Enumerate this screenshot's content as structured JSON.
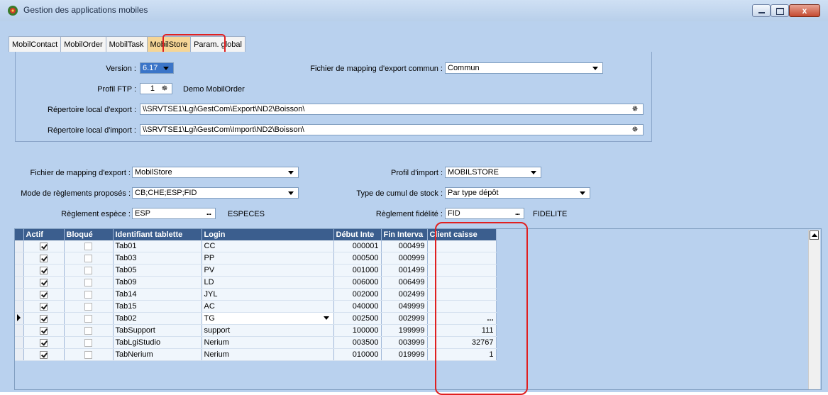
{
  "window": {
    "title": "Gestion des applications mobiles",
    "close_glyph": "x"
  },
  "tabs": [
    {
      "label": "MobilContact",
      "active": false
    },
    {
      "label": "MobilOrder",
      "active": false
    },
    {
      "label": "MobilTask",
      "active": false
    },
    {
      "label": "MobilStore",
      "active": true
    },
    {
      "label": "Param. global",
      "active": false
    }
  ],
  "panel_top": {
    "version_label": "Version :",
    "version_value": "6.17",
    "mapping_common_label": "Fichier de mapping d'export commun :",
    "mapping_common_value": "Commun",
    "profil_ftp_label": "Profil FTP :",
    "profil_ftp_value": "1",
    "profil_ftp_name": "Demo MobilOrder",
    "export_dir_label": "Répertoire local d'export :",
    "export_dir_value": "\\\\SRVTSE1\\Lgi\\GestCom\\Export\\ND2\\Boisson\\",
    "import_dir_label": "Répertoire local d'import :",
    "import_dir_value": "\\\\SRVTSE1\\Lgi\\GestCom\\Import\\ND2\\Boisson\\"
  },
  "panel_mid": {
    "mapping_export_label": "Fichier de mapping d'export :",
    "mapping_export_value": "MobilStore",
    "profil_import_label": "Profil d'import :",
    "profil_import_value": "MOBILSTORE",
    "reglements_label": "Mode de règlements proposés :",
    "reglements_value": "CB;CHE;ESP;FID",
    "cumul_label": "Type de cumul de stock :",
    "cumul_value": "Par type dépôt",
    "espece_label": "Règlement espèce :",
    "espece_value": "ESP",
    "espece_name": "ESPECES",
    "fidelite_label": "Règlement fidélité :",
    "fidelite_value": "FID",
    "fidelite_name": "FIDELITE",
    "dots": "..."
  },
  "grid": {
    "columns": [
      "Actif",
      "Bloqué",
      "Identifiant tablette",
      "Login",
      "Début Inte",
      "Fin Interva",
      "Client caisse"
    ],
    "rows": [
      {
        "actif": true,
        "bloque": false,
        "id": "Tab01",
        "login": "CC",
        "debut": "000001",
        "fin": "000499",
        "client": ""
      },
      {
        "actif": true,
        "bloque": false,
        "id": "Tab03",
        "login": "PP",
        "debut": "000500",
        "fin": "000999",
        "client": ""
      },
      {
        "actif": true,
        "bloque": false,
        "id": "Tab05",
        "login": "PV",
        "debut": "001000",
        "fin": "001499",
        "client": ""
      },
      {
        "actif": true,
        "bloque": false,
        "id": "Tab09",
        "login": "LD",
        "debut": "006000",
        "fin": "006499",
        "client": ""
      },
      {
        "actif": true,
        "bloque": false,
        "id": "Tab14",
        "login": "JYL",
        "debut": "002000",
        "fin": "002499",
        "client": ""
      },
      {
        "actif": true,
        "bloque": false,
        "id": "Tab15",
        "login": "AC",
        "debut": "040000",
        "fin": "049999",
        "client": ""
      },
      {
        "actif": true,
        "bloque": false,
        "id": "Tab02",
        "login": "TG",
        "debut": "002500",
        "fin": "002999",
        "client": "...",
        "current": true
      },
      {
        "actif": true,
        "bloque": false,
        "id": "TabSupport",
        "login": "support",
        "debut": "100000",
        "fin": "199999",
        "client": "111"
      },
      {
        "actif": true,
        "bloque": false,
        "id": "TabLgiStudio",
        "login": "Nerium",
        "debut": "003500",
        "fin": "003999",
        "client": "32767"
      },
      {
        "actif": true,
        "bloque": false,
        "id": "TabNerium",
        "login": "Nerium",
        "debut": "010000",
        "fin": "019999",
        "client": "1"
      }
    ]
  },
  "colors": {
    "titlebar": "#b8cfea",
    "panel": "#b9d1ee",
    "grid_header": "#3b5e8e",
    "active_tab": "#f5d596",
    "highlight": "#e02020"
  }
}
